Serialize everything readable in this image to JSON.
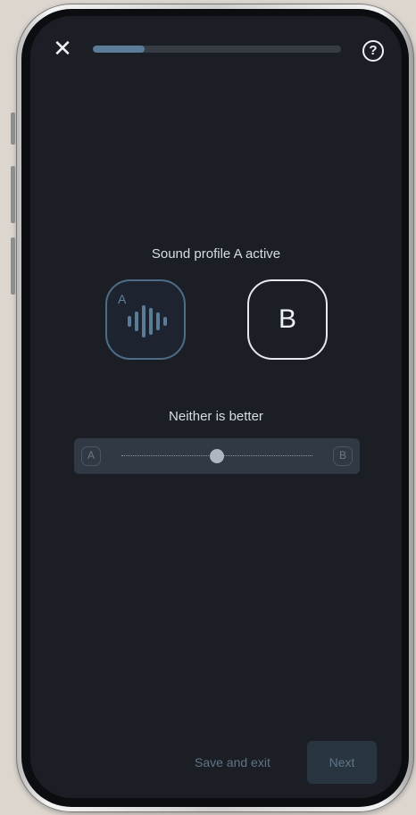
{
  "header": {
    "close_glyph": "✕",
    "help_glyph": "?",
    "progress_fraction": 0.21
  },
  "main": {
    "status_text": "Sound profile A active",
    "profile_a_letter": "A",
    "profile_b_letter": "B",
    "comparison_label": "Neither is better",
    "slider": {
      "left_label": "A",
      "right_label": "B",
      "position_fraction": 0.5
    }
  },
  "footer": {
    "save_exit_label": "Save and exit",
    "next_label": "Next"
  },
  "colors": {
    "screen_bg": "#1b1f25",
    "accent": "#5b7c96",
    "text": "#d7dde3",
    "muted": "#5f7486"
  }
}
